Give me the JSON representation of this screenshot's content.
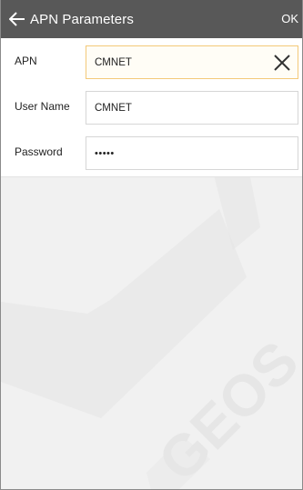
{
  "header": {
    "title": "APN Parameters",
    "ok_label": "OK"
  },
  "form": {
    "apn": {
      "label": "APN",
      "value": "CMNET"
    },
    "username": {
      "label": "User Name",
      "value": "CMNET"
    },
    "password": {
      "label": "Password",
      "masked_value": "•••••"
    }
  },
  "watermark": {
    "text": "GEOS"
  },
  "colors": {
    "header_bg": "#585858",
    "active_border": "#f3c979",
    "page_bg": "#f1f1f1"
  }
}
